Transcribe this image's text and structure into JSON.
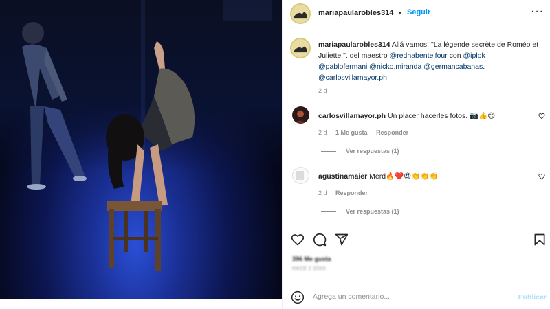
{
  "post": {
    "username": "mariapaularobles314",
    "follow_label": "Seguir",
    "separator": "•",
    "more_label": "···"
  },
  "caption": {
    "username": "mariapaularobles314",
    "text_before": " Allá vamos! \"La légende secrète de Roméo et Juliette \". del maestro ",
    "mention_1": "@redhabenteifour",
    "text_mid": " con ",
    "mention_2": "@iplok",
    "mention_3": "@pablofermani",
    "mention_4": "@nicko.miranda",
    "mention_5": "@germancabanas",
    "text_end": ".",
    "mention_6": "@carlosvillamayor.ph",
    "time": "2 d"
  },
  "comments": [
    {
      "username": "carlosvillamayor.ph",
      "text": "Un placer hacerles fotos. 📷👍😊",
      "time": "2 d",
      "likes": "1 Me gusta",
      "reply_label": "Responder",
      "view_replies": "Ver respuestas (1)"
    },
    {
      "username": "agustinamaier",
      "text": "Merd🔥❤️😍👏👏👏",
      "time": "2 d",
      "reply_label": "Responder",
      "view_replies": "Ver respuestas (1)"
    }
  ],
  "likes_count": "396 Me gusta",
  "date": "HACE 2 DÍAS",
  "add_comment": {
    "placeholder": "Agrega un comentario...",
    "publish_label": "Publicar"
  },
  "icons": {
    "like": "heart-icon",
    "comment": "comment-icon",
    "share": "share-icon",
    "save": "bookmark-icon",
    "emoji": "emoji-icon",
    "more": "more-icon"
  },
  "colors": {
    "link": "#0095f6",
    "mention": "#00376b",
    "muted": "#8e8e8e",
    "stage_light": "#2a4fd6"
  }
}
